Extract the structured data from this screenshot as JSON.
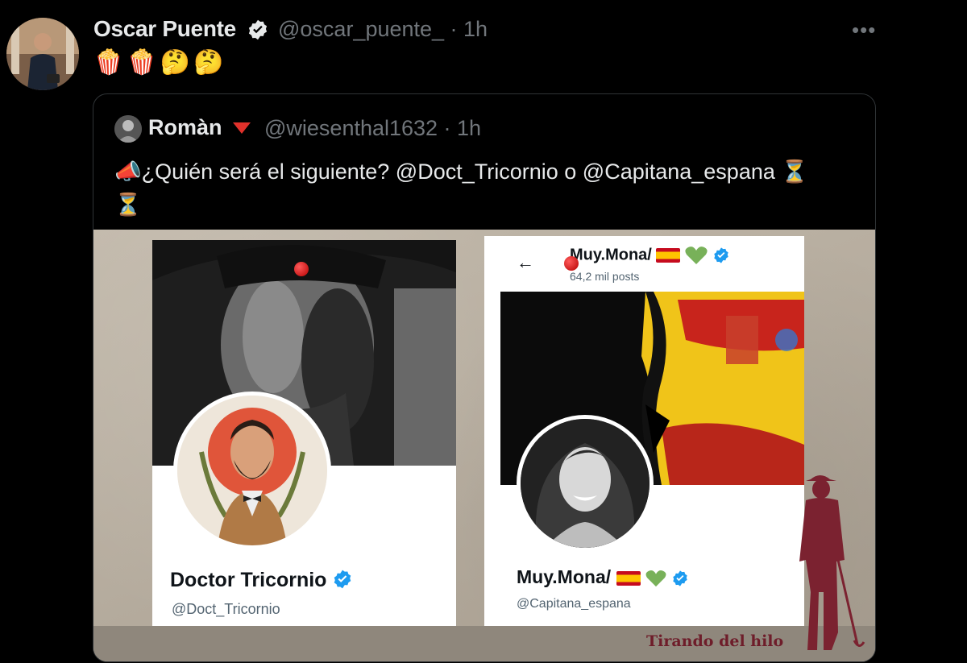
{
  "tweet": {
    "author_name": "Oscar Puente",
    "author_handle": "@oscar_puente_ · 1h",
    "emoji_text": "🍿🍿🤔🤔",
    "more_icon": "more-horizontal-icon"
  },
  "quote": {
    "author_name": "Romàn",
    "author_handle": "@wiesenthal1632 · 1h",
    "text_prefix": "📣",
    "text": "¿Quién será el siguiente? @Doct_Tricornio o @Capitana_espana",
    "text_suffix": "⏳",
    "text_line2": "⏳"
  },
  "media": {
    "left_card": {
      "name": "Doctor Tricornio",
      "handle": "@Doct_Tricornio"
    },
    "right_card": {
      "header_name": "Muy.Mona/",
      "post_count": "64,2 mil posts",
      "name": "Muy.Mona/",
      "handle": "@Capitana_espana"
    },
    "watermark": "Tirando del hilo"
  },
  "colors": {
    "verified_blue": "#1d9bf0",
    "muted": "#71767b",
    "watermark": "#6e1d2a"
  }
}
